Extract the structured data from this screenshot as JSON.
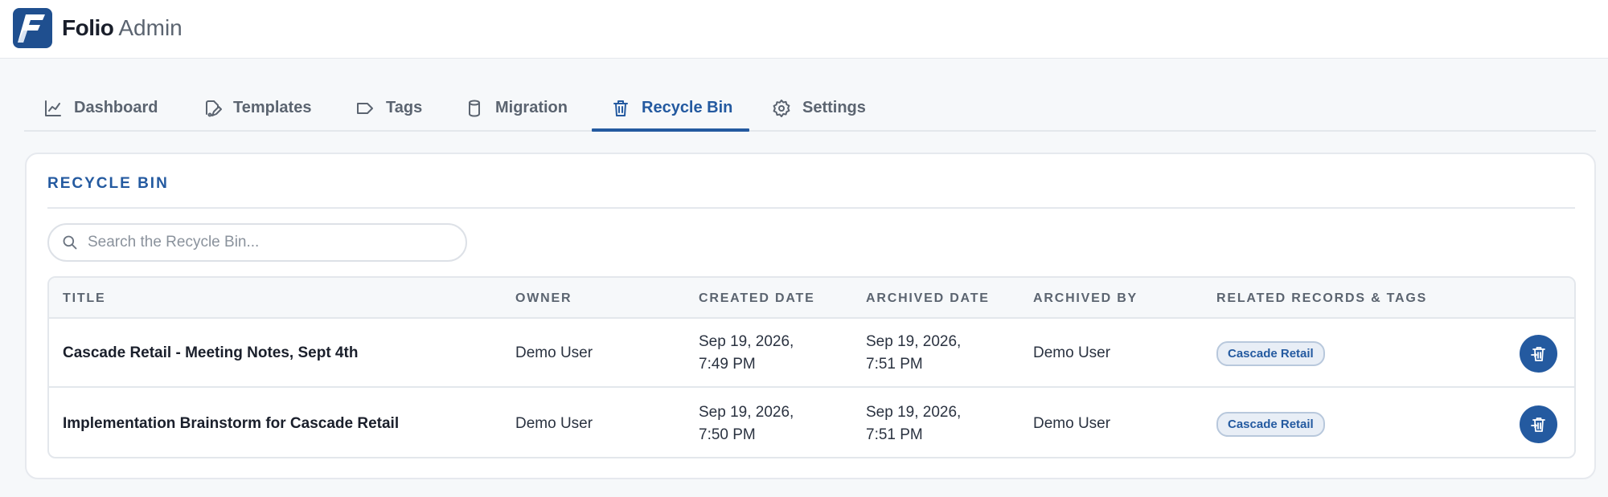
{
  "app": {
    "name": "Folio",
    "suffix": "Admin"
  },
  "tabs": [
    {
      "label": "Dashboard",
      "icon": "chart-line-icon",
      "active": false
    },
    {
      "label": "Templates",
      "icon": "template-icon",
      "active": false
    },
    {
      "label": "Tags",
      "icon": "tag-icon",
      "active": false
    },
    {
      "label": "Migration",
      "icon": "database-icon",
      "active": false
    },
    {
      "label": "Recycle Bin",
      "icon": "trash-icon",
      "active": true
    },
    {
      "label": "Settings",
      "icon": "gear-icon",
      "active": false
    }
  ],
  "panel": {
    "title": "RECYCLE BIN",
    "search_placeholder": "Search the Recycle Bin..."
  },
  "table": {
    "columns": [
      "TITLE",
      "OWNER",
      "CREATED DATE",
      "ARCHIVED DATE",
      "ARCHIVED BY",
      "RELATED RECORDS & TAGS"
    ],
    "rows": [
      {
        "title": "Cascade Retail - Meeting Notes, Sept 4th",
        "owner": "Demo User",
        "created": "Sep 19, 2026, 7:49 PM",
        "archived": "Sep 19, 2026, 7:51 PM",
        "archived_by": "Demo User",
        "tag": "Cascade Retail"
      },
      {
        "title": "Implementation Brainstorm for Cascade Retail",
        "owner": "Demo User",
        "created": "Sep 19, 2026, 7:50 PM",
        "archived": "Sep 19, 2026, 7:51 PM",
        "archived_by": "Demo User",
        "tag": "Cascade Retail"
      }
    ]
  },
  "colors": {
    "accent": "#245aa0",
    "logo_bg": "#1f4f8f",
    "tag_bg": "#e8eef6"
  }
}
